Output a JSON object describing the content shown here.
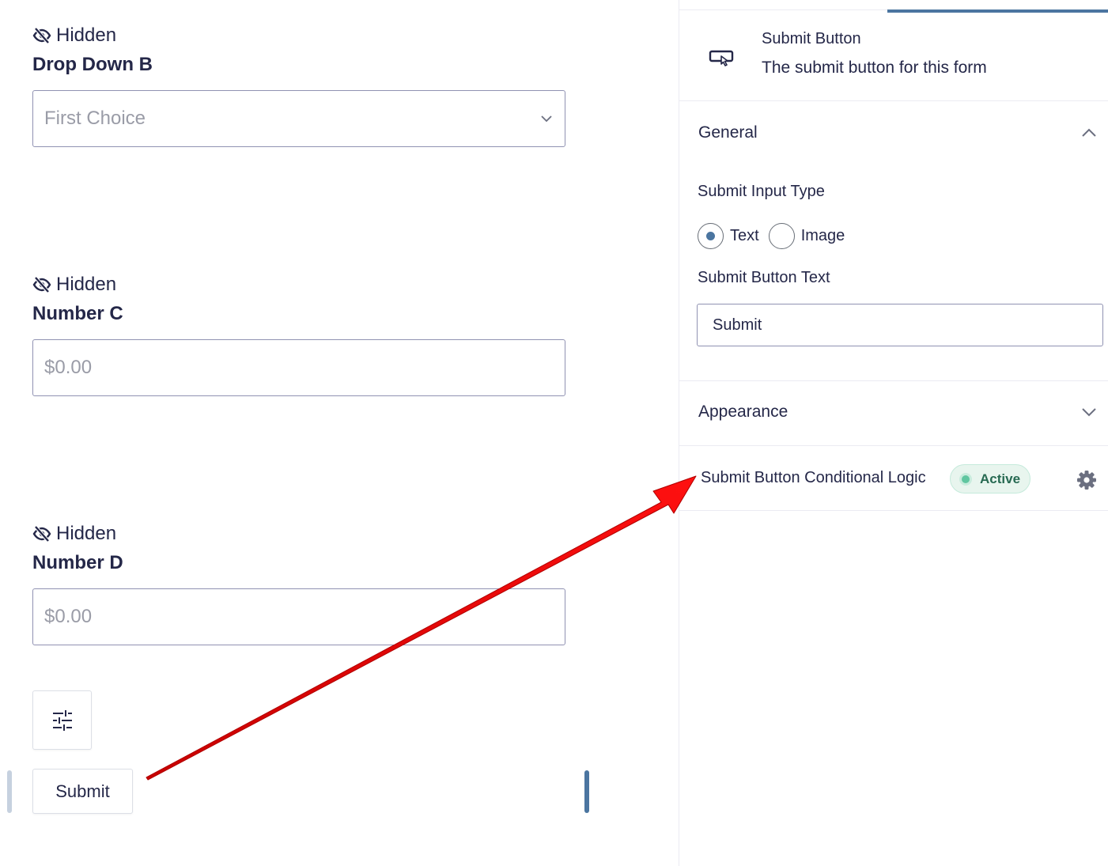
{
  "canvas": {
    "fields": [
      {
        "hidden_label": "Hidden",
        "label": "Drop Down B",
        "placeholder": "First Choice",
        "type": "select"
      },
      {
        "hidden_label": "Hidden",
        "label": "Number C",
        "placeholder": "$0.00",
        "type": "number"
      },
      {
        "hidden_label": "Hidden",
        "label": "Number D",
        "placeholder": "$0.00",
        "type": "number"
      }
    ],
    "submit_label": "Submit"
  },
  "sidebar": {
    "field_title": "Submit Button",
    "field_description": "The submit button for this form",
    "general": {
      "title": "General",
      "input_type_label": "Submit Input Type",
      "options": [
        {
          "label": "Text",
          "selected": true
        },
        {
          "label": "Image",
          "selected": false
        }
      ],
      "button_text_label": "Submit Button Text",
      "button_text_value": "Submit"
    },
    "appearance": {
      "title": "Appearance"
    },
    "logic": {
      "label": "Submit Button Conditional Logic",
      "status": "Active"
    }
  },
  "colors": {
    "accent": "#4b75a0",
    "arrow": "#e00000",
    "active_badge_bg": "#e8f5ee",
    "active_badge_text": "#276a52"
  }
}
